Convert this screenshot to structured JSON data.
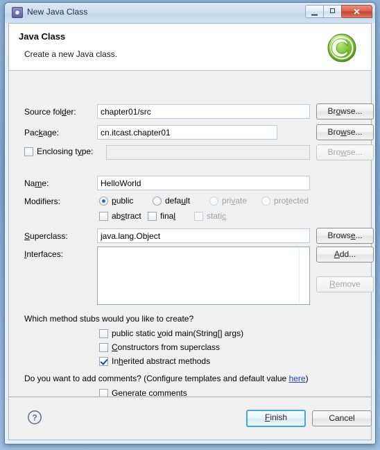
{
  "window": {
    "title": "New Java Class",
    "icon": "java-class-wizard-icon",
    "controls": {
      "minimize": "minimize-icon",
      "maximize": "maximize-icon",
      "close": "close-icon"
    }
  },
  "header": {
    "title": "Java Class",
    "subtitle": "Create a new Java class.",
    "logo": "green-c-class-icon"
  },
  "form": {
    "source_folder": {
      "label_pre": "Source fol",
      "label_mnemonic": "d",
      "label_post": "er:",
      "value": "chapter01/src",
      "browse": {
        "pre": "Br",
        "mnemonic": "o",
        "post": "wse...",
        "enabled": true
      }
    },
    "package": {
      "label_pre": "Pac",
      "label_mnemonic": "k",
      "label_post": "age:",
      "value": "cn.itcast.chapter01",
      "browse": {
        "pre": "Bro",
        "mnemonic": "w",
        "post": "se...",
        "enabled": true
      }
    },
    "enclosing_type": {
      "checkbox_checked": false,
      "label_pre": "Enclosing t",
      "label_mnemonic": "y",
      "label_post": "pe:",
      "value": "",
      "enabled": false,
      "browse": {
        "pre": "Bro",
        "mnemonic": "w",
        "post": "se...",
        "enabled": false
      }
    },
    "name": {
      "label_pre": "Na",
      "label_mnemonic": "m",
      "label_post": "e:",
      "value": "HelloWorld"
    },
    "modifiers": {
      "label": "Modifiers:",
      "access": [
        {
          "pre": "",
          "mnemonic": "p",
          "post": "ublic",
          "selected": true,
          "enabled": true
        },
        {
          "pre": "defa",
          "mnemonic": "u",
          "post": "lt",
          "selected": false,
          "enabled": true
        },
        {
          "pre": "pri",
          "mnemonic": "v",
          "post": "ate",
          "selected": false,
          "enabled": false
        },
        {
          "pre": "pro",
          "mnemonic": "t",
          "post": "ected",
          "selected": false,
          "enabled": false
        }
      ],
      "flags": [
        {
          "pre": "ab",
          "mnemonic": "s",
          "post": "tract",
          "checked": false,
          "enabled": true
        },
        {
          "pre": "fina",
          "mnemonic": "l",
          "post": "",
          "checked": false,
          "enabled": true
        },
        {
          "pre": "stati",
          "mnemonic": "c",
          "post": "",
          "checked": false,
          "enabled": false
        }
      ]
    },
    "superclass": {
      "label_pre": "",
      "label_mnemonic": "S",
      "label_post": "uperclass:",
      "value": "java.lang.Object",
      "browse": {
        "pre": "Brows",
        "mnemonic": "e",
        "post": "...",
        "enabled": true
      }
    },
    "interfaces": {
      "label_pre": "",
      "label_mnemonic": "I",
      "label_post": "nterfaces:",
      "items": [],
      "add": {
        "pre": "",
        "mnemonic": "A",
        "post": "dd...",
        "enabled": true
      },
      "remove": {
        "pre": "",
        "mnemonic": "R",
        "post": "emove",
        "enabled": false
      }
    },
    "method_stubs": {
      "question": "Which method stubs would you like to create?",
      "options": [
        {
          "pre": "public static ",
          "mnemonic": "v",
          "post": "oid main(String[] args)",
          "checked": false
        },
        {
          "pre": "",
          "mnemonic": "C",
          "post": "onstructors from superclass",
          "checked": false
        },
        {
          "pre": "In",
          "mnemonic": "h",
          "post": "erited abstract methods",
          "checked": true
        }
      ]
    },
    "comments": {
      "question_pre": "Do you want to add comments? (Configure templates and default value ",
      "link": "here",
      "question_post": ")",
      "option": {
        "pre": "",
        "mnemonic": "G",
        "post": "enerate comments",
        "checked": false
      }
    }
  },
  "footer": {
    "help": "help-icon",
    "finish": {
      "pre": "",
      "mnemonic": "F",
      "post": "inish"
    },
    "cancel": {
      "pre": "Cancel",
      "mnemonic": "",
      "post": ""
    }
  },
  "colors": {
    "accent": "#3fa7e0",
    "link": "#1a41c8",
    "logo_green": "#77c13b",
    "header_bg": "#ffffff",
    "dialog_bg": "#f0f0f0"
  }
}
